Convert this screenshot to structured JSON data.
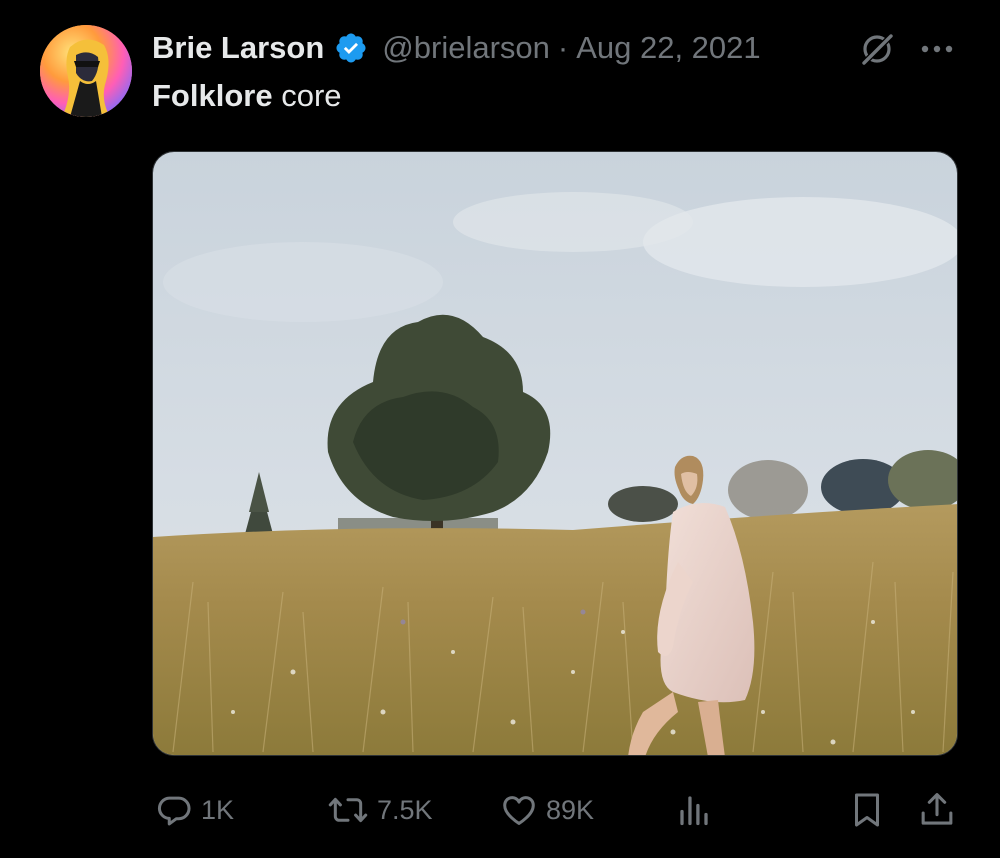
{
  "tweet": {
    "author_name": "Brie Larson",
    "handle": "@brielarson",
    "separator": "·",
    "date": "Aug 22, 2021",
    "text_bold": "Folklore",
    "text_rest": " core"
  },
  "metrics": {
    "replies": "1K",
    "retweets": "7.5K",
    "likes": "89K"
  },
  "colors": {
    "background": "#000000",
    "primary_text": "#e7e9ea",
    "secondary_text": "#71767b",
    "verified_blue": "#1d9bf0"
  },
  "icons": {
    "verified": "verified-badge-icon",
    "grok": "grok-icon",
    "more": "more-icon",
    "reply": "reply-icon",
    "retweet": "retweet-icon",
    "like": "heart-icon",
    "views": "analytics-icon",
    "bookmark": "bookmark-icon",
    "share": "share-icon"
  }
}
